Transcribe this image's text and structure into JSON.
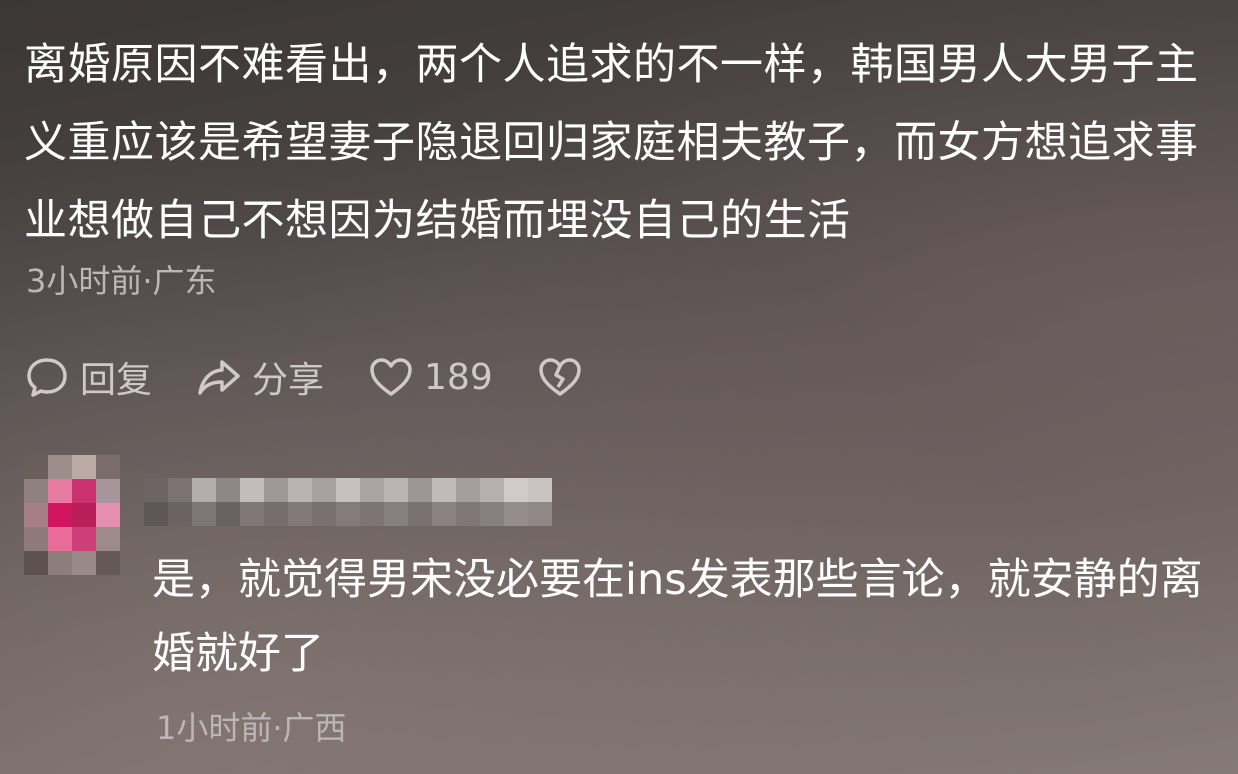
{
  "comment": {
    "text": "离婚原因不难看出，两个人追求的不一样，韩国男人大男子主义重应该是希望妻子隐退回归家庭相夫教子，而女方想追求事业想做自己不想因为结婚而埋没自己的生活",
    "meta": "3小时前·广东"
  },
  "actions": {
    "reply_label": "回复",
    "share_label": "分享",
    "like_count": "189",
    "reply_icon": "chat-bubble-icon",
    "share_icon": "share-arrow-icon",
    "like_icon": "heart-icon",
    "dislike_icon": "broken-heart-icon"
  },
  "reply": {
    "text": "是，就觉得男宋没必要在ins发表那些言论，就安静的离婚就好了",
    "meta": "1小时前·广西"
  },
  "colors": {
    "text": "#ffffff",
    "meta_text": "#bdb6b4",
    "action_text": "#cfc9c7",
    "avatar_accent": "#d2155f"
  }
}
